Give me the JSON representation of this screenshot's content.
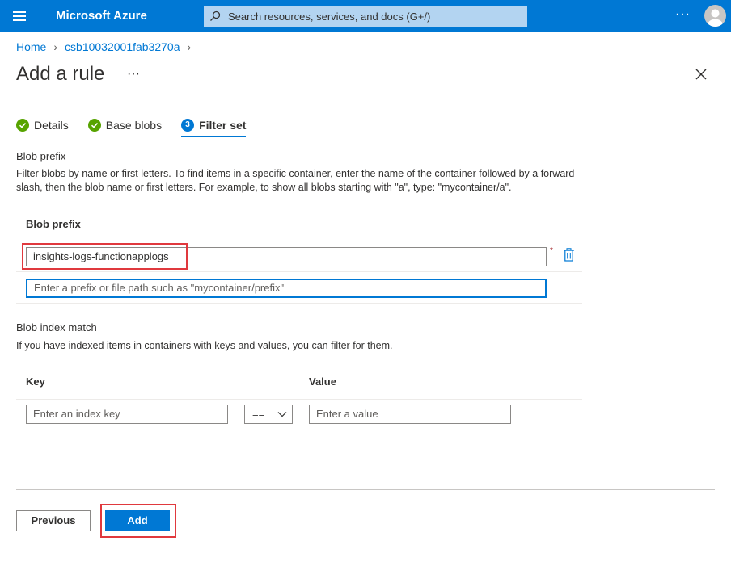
{
  "header": {
    "brand": "Microsoft Azure",
    "search_placeholder": "Search resources, services, and docs (G+/)",
    "more": "···"
  },
  "breadcrumb": {
    "items": [
      "Home",
      "csb10032001fab3270a"
    ]
  },
  "page": {
    "title": "Add a rule",
    "more": "···"
  },
  "tabs": [
    {
      "label": "Details",
      "status": "done"
    },
    {
      "label": "Base blobs",
      "status": "done"
    },
    {
      "label": "Filter set",
      "status": "active",
      "number": "3"
    }
  ],
  "blob_prefix": {
    "section_label": "Blob prefix",
    "description": "Filter blobs by name or first letters. To find items in a specific container, enter the name of the container followed by a forward slash, then the blob name or first letters. For example, to show all blobs starting with \"a\", type: \"mycontainer/a\".",
    "column_header": "Blob prefix",
    "value": "insights-logs-functionapplogs",
    "required_marker": "*",
    "new_placeholder": "Enter a prefix or file path such as \"mycontainer/prefix\""
  },
  "blob_index": {
    "section_label": "Blob index match",
    "description": "If you have indexed items in containers with keys and values, you can filter for them.",
    "key_header": "Key",
    "value_header": "Value",
    "key_placeholder": "Enter an index key",
    "operator": "==",
    "value_placeholder": "Enter a value"
  },
  "footer": {
    "previous": "Previous",
    "add": "Add"
  },
  "colors": {
    "accent": "#0078d4",
    "success": "#57a300",
    "highlight": "#e0393e"
  }
}
